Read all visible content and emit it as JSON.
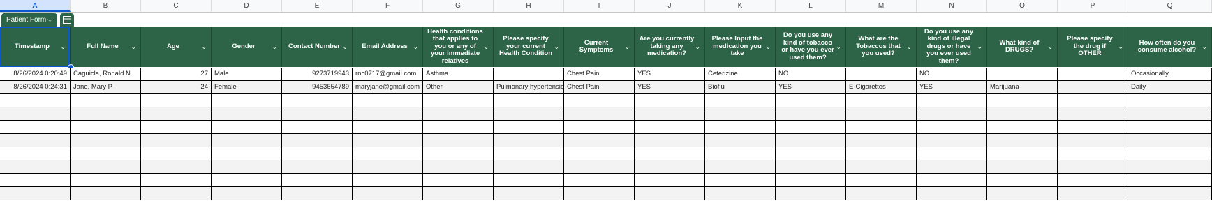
{
  "column_letters": [
    "A",
    "B",
    "C",
    "D",
    "E",
    "F",
    "G",
    "H",
    "I",
    "J",
    "K",
    "L",
    "M",
    "N",
    "O",
    "P",
    "Q"
  ],
  "table": {
    "name": "Patient Form"
  },
  "headers": [
    "Timestamp",
    "Full Name",
    "Age",
    "Gender",
    "Contact Number",
    "Email Address",
    "Health conditions that applies to you or any of your immediate relatives",
    "Please specify your current Health Condition",
    "Current Symptoms",
    "Are you currently taking any medication?",
    "Please Input the medication you take",
    "Do you use any kind of tobacco or have you ever used them?",
    "What are the Tobaccos that you used?",
    "Do you use any kind of illegal drugs or have you ever used them?",
    "What kind of DRUGS?",
    "Please specify the drug if OTHER",
    "How often do you consume alcohol?"
  ],
  "rows": [
    [
      "8/26/2024 0:20:49",
      "Caguicla, Ronald N",
      "27",
      "Male",
      "9273719943",
      "rnc0717@gmail.com",
      "Asthma",
      "",
      "Chest Pain",
      "YES",
      "Ceterizine",
      "NO",
      "",
      "NO",
      "",
      "",
      "Occasionally"
    ],
    [
      "8/26/2024 0:24:31",
      "Jane, Mary P",
      "24",
      "Female",
      "9453654789",
      "maryjane@gmail.com",
      "Other",
      "Pulmonary hypertension",
      "Chest Pain",
      "YES",
      "Bioflu",
      "YES",
      "E-Cigarettes",
      "YES",
      "Marijuana",
      "",
      "Daily"
    ]
  ],
  "colors": {
    "header_bg": "#2d6448",
    "selection": "#0b57d0"
  }
}
